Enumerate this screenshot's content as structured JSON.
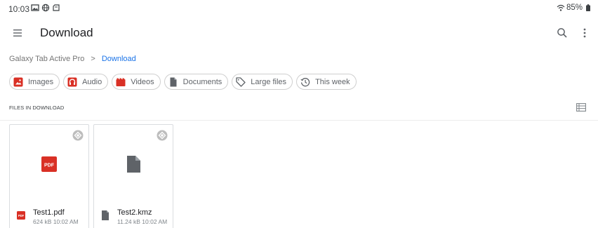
{
  "status_bar": {
    "time": "10:03",
    "left_icons": [
      "image-icon",
      "globe-icon",
      "screenshot-icon"
    ],
    "battery_text": "85%",
    "right_icons": [
      "wifi-icon",
      "battery-icon"
    ]
  },
  "app_bar": {
    "title": "Download",
    "icons": [
      "menu-icon",
      "search-icon",
      "more-vert-icon"
    ]
  },
  "breadcrumb": {
    "root": "Galaxy Tab Active Pro",
    "separator": ">",
    "current": "Download"
  },
  "filter_chips": [
    {
      "label": "Images",
      "icon": "image-icon"
    },
    {
      "label": "Audio",
      "icon": "headphones-icon"
    },
    {
      "label": "Videos",
      "icon": "movie-icon"
    },
    {
      "label": "Documents",
      "icon": "document-icon"
    },
    {
      "label": "Large files",
      "icon": "tag-icon"
    },
    {
      "label": "This week",
      "icon": "history-icon"
    }
  ],
  "section": {
    "label": "FILES IN DOWNLOAD",
    "view_toggle_icon": "list-view-icon"
  },
  "files": [
    {
      "name": "Test1.pdf",
      "meta": "624 kB 10:02 AM",
      "type_icon": "pdf-icon",
      "thumb_label": "PDF"
    },
    {
      "name": "Test2.kmz",
      "meta": "11.24 kB 10:02 AM",
      "type_icon": "file-icon"
    }
  ],
  "colors": {
    "accent": "#1a73e8",
    "pdf_red": "#d93025",
    "chip_border": "#cfcfcf",
    "icon_gray": "#5f6368"
  }
}
